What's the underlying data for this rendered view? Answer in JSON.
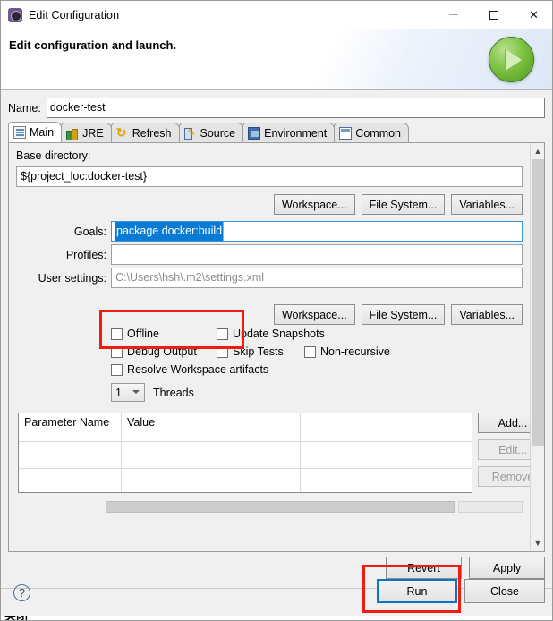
{
  "window": {
    "title": "Edit Configuration",
    "app_icon": "eclipse-gear-icon",
    "minimize": "–",
    "maximize": "□",
    "close": "✕"
  },
  "banner": {
    "heading": "Edit configuration and launch.",
    "run_orb_icon": "green-run-play-icon"
  },
  "name_row": {
    "label": "Name:",
    "value": "docker-test"
  },
  "tabs": [
    {
      "label": "Main",
      "icon": "main-document-icon",
      "active": true
    },
    {
      "label": "JRE",
      "icon": "jre-books-icon",
      "active": false
    },
    {
      "label": "Refresh",
      "icon": "refresh-arrows-icon",
      "active": false
    },
    {
      "label": "Source",
      "icon": "source-pencil-icon",
      "active": false
    },
    {
      "label": "Environment",
      "icon": "environment-icon",
      "active": false
    },
    {
      "label": "Common",
      "icon": "common-window-icon",
      "active": false
    }
  ],
  "main_tab": {
    "base_directory": {
      "label": "Base directory:",
      "value": "${project_loc:docker-test}"
    },
    "browse_buttons_top": [
      "Workspace...",
      "File System...",
      "Variables..."
    ],
    "goals": {
      "label": "Goals:",
      "value": "package docker:build",
      "selected": true
    },
    "profiles": {
      "label": "Profiles:",
      "value": ""
    },
    "user_settings": {
      "label": "User settings:",
      "value": "C:\\Users\\hsh\\.m2\\settings.xml"
    },
    "browse_buttons_bottom": [
      "Workspace...",
      "File System...",
      "Variables..."
    ],
    "checkboxes": [
      {
        "label": "Offline",
        "checked": false
      },
      {
        "label": "Update Snapshots",
        "checked": false
      },
      {
        "label": "Debug Output",
        "checked": false
      },
      {
        "label": "Skip Tests",
        "checked": false
      },
      {
        "label": "Non-recursive",
        "checked": false
      },
      {
        "label": "Resolve Workspace artifacts",
        "checked": false
      }
    ],
    "threads": {
      "value": "1",
      "label": "Threads"
    },
    "parameter_table": {
      "columns": [
        "Parameter Name",
        "Value",
        ""
      ],
      "rows": []
    },
    "table_buttons": [
      {
        "label": "Add...",
        "enabled": true
      },
      {
        "label": "Edit...",
        "enabled": false
      },
      {
        "label": "Remove",
        "enabled": false
      }
    ]
  },
  "footer": {
    "revert": "Revert",
    "apply": "Apply",
    "run": "Run",
    "close": "Close",
    "help_icon": "help-question-icon"
  },
  "annotations": {
    "goals_highlight_color": "#f01c0e",
    "run_highlight_color": "#f01c0e",
    "selection_color": "#0a7bd4",
    "focus_border_color": "#0c74c4"
  }
}
